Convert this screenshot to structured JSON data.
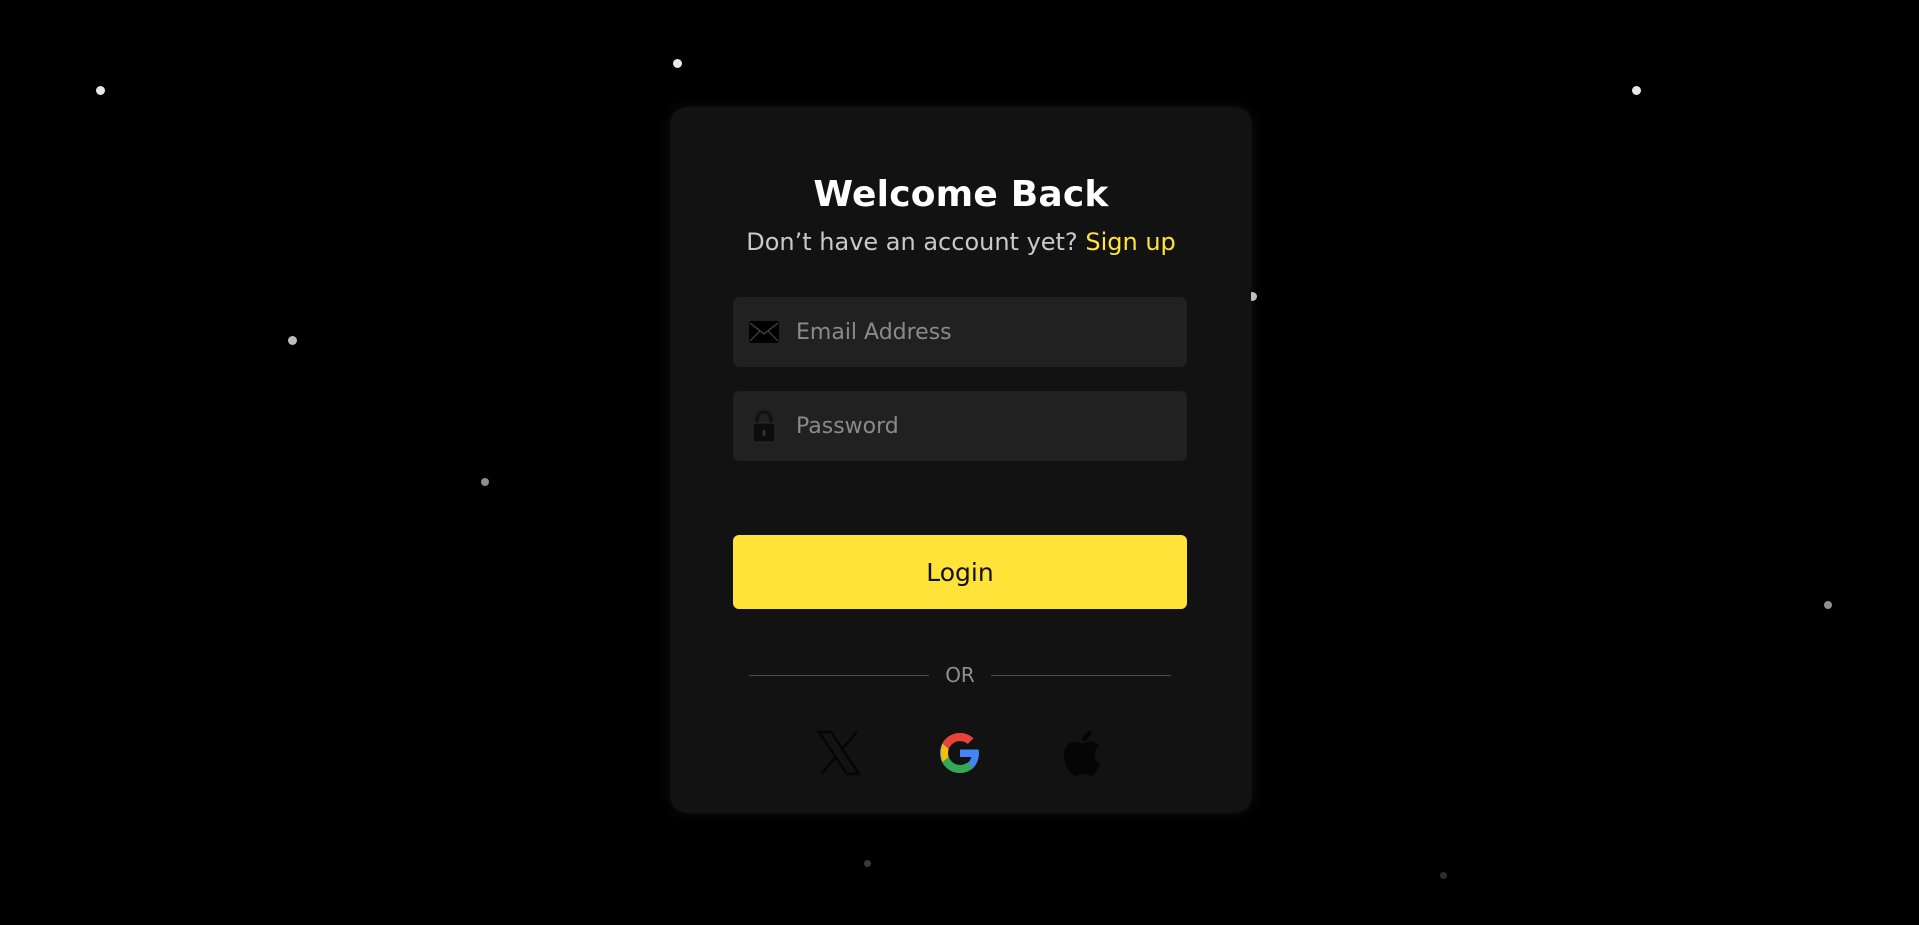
{
  "login": {
    "title": "Welcome Back",
    "subtitle_text": "Don’t have an account yet?",
    "signup_link": "Sign up",
    "email_placeholder": "Email Address",
    "password_placeholder": "Password",
    "login_label": "Login",
    "divider_text": "OR"
  },
  "social": {
    "icons": [
      "x-icon",
      "google-icon",
      "apple-icon"
    ]
  },
  "colors": {
    "background": "#000000",
    "card": "#121212",
    "field": "#212121",
    "accent": "#ffe338",
    "title": "#ffffff",
    "subtitle": "#c9c9c9",
    "placeholder": "#8a8a8a"
  }
}
